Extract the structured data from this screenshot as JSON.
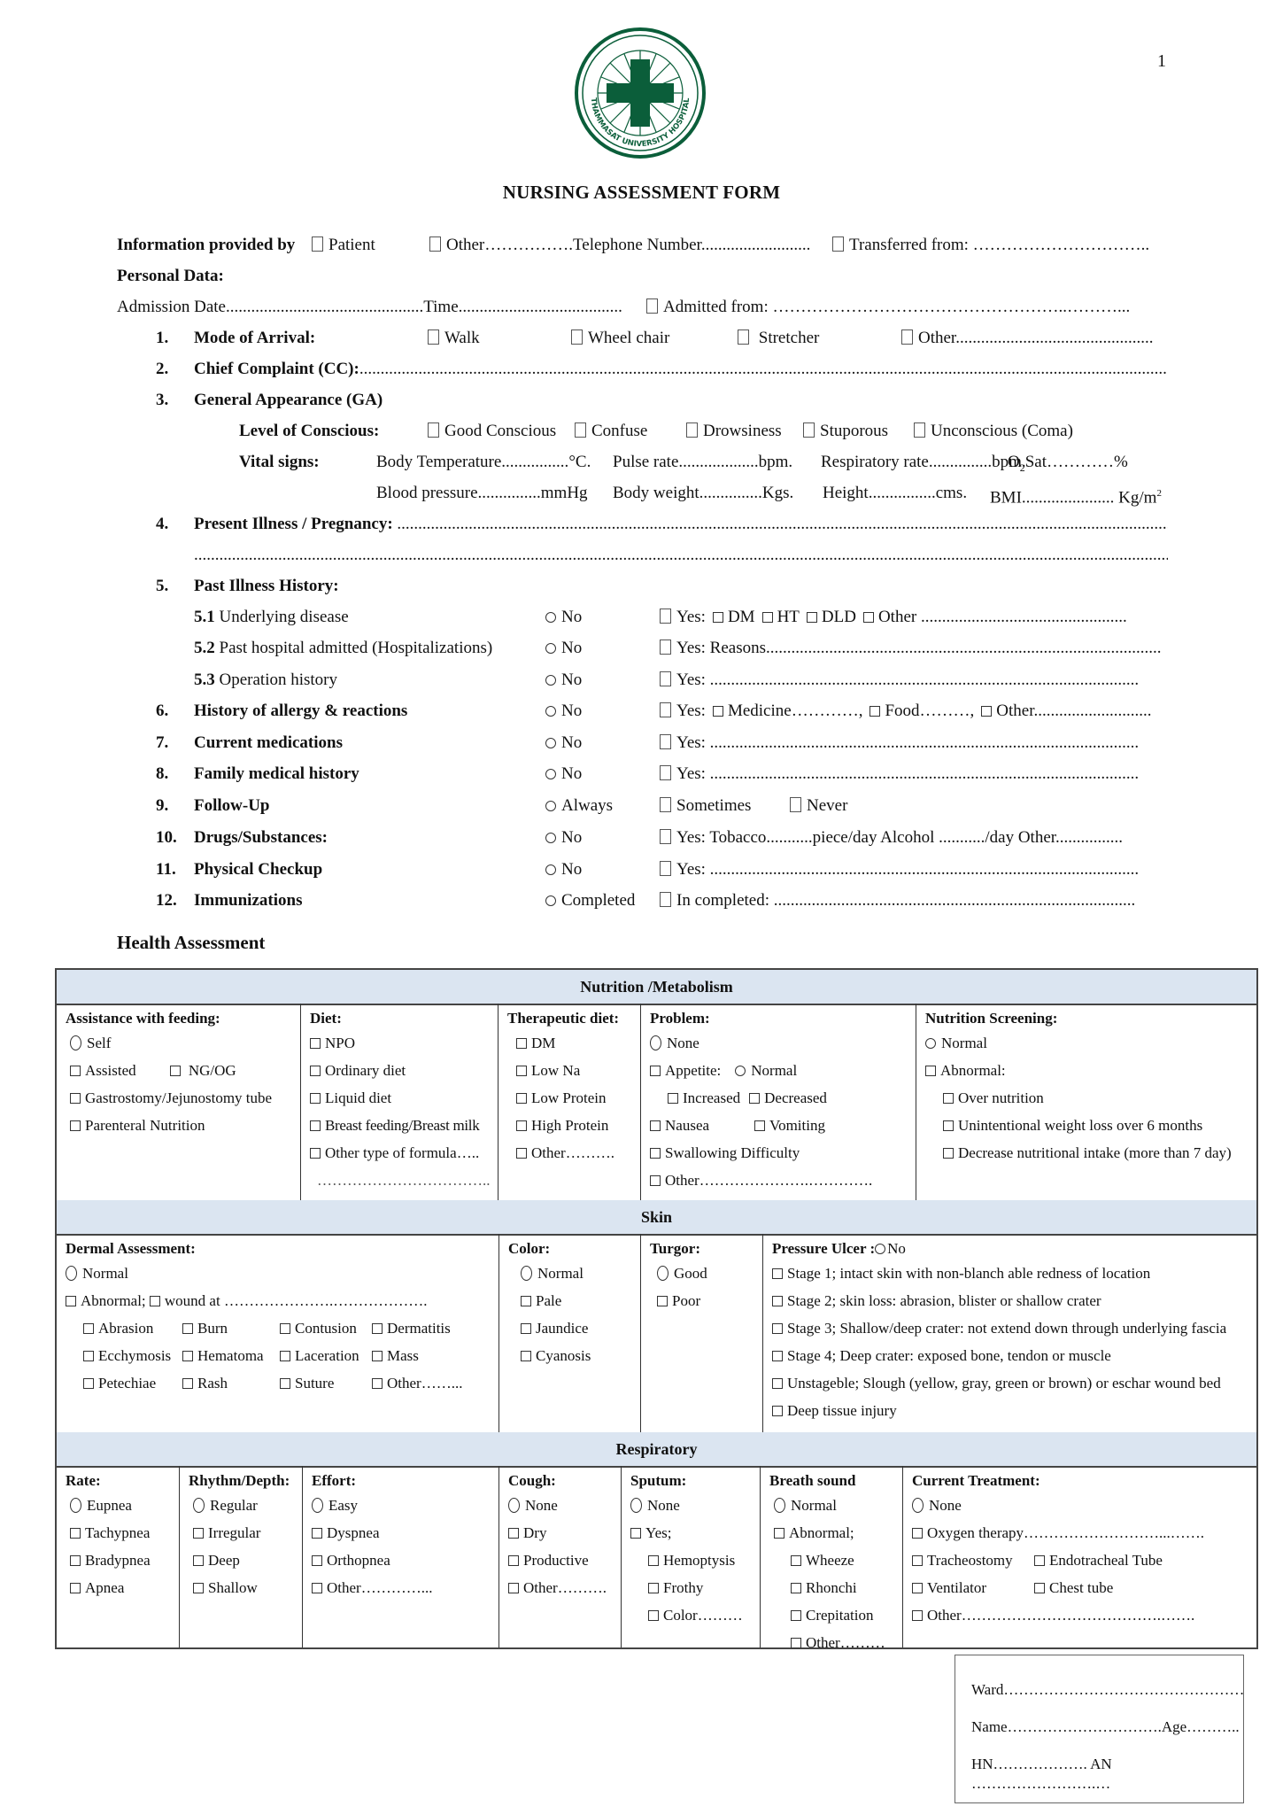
{
  "page": {
    "number": "1",
    "title": "NURSING ASSESSMENT FORM",
    "logo": {
      "icon": "hospital-seal-cross-icon",
      "text": "THAMMASAT UNIVERSITY HOSPITAL",
      "color": "#0b5e3a"
    }
  },
  "info": {
    "label": "Information provided by",
    "patient": "Patient",
    "other": "Other…………….Telephone Number..........................",
    "transferred": "Transferred from: …………………………..",
    "personal_label": "Personal Data:",
    "admission": "Admission Date...............................................Time.......................................",
    "admitted_from": "Admitted from: ……………………………………………..………..."
  },
  "items": {
    "i1": {
      "num": "1.",
      "label": "Mode of Arrival:",
      "options": [
        "Walk",
        "Wheel chair",
        "Stretcher",
        "Other..............................................."
      ]
    },
    "i2": {
      "num": "2.",
      "label": "Chief Complaint (CC):",
      "line": "................................................................................................................................................................................................................................................"
    },
    "i3": {
      "num": "3.",
      "label": "General Appearance (GA)",
      "conscious_label": "Level of Conscious:",
      "conscious_options": [
        "Good Conscious",
        "Confuse",
        "Drowsiness",
        "Stuporous",
        "Unconscious (Coma)"
      ],
      "vital_label": "Vital signs:",
      "vital_row1": [
        "Body Temperature................",
        "°C.",
        "Pulse rate...................bpm.",
        "Respiratory rate...............bpm.",
        "O",
        "2",
        "Sat…………%"
      ],
      "vital_row2": [
        "Blood pressure...............mmHg",
        "Body weight...............Kgs.",
        "Height................cms.",
        "BMI...................... Kg/m",
        "2"
      ]
    },
    "i4": {
      "num": "4.",
      "label": "Present Illness / Pregnancy:",
      "line1": "..................................................................................................................................................................................................................",
      "line2": "....................................................................................................................................................................................................................................................."
    },
    "i5": {
      "num": "5.",
      "label": "Past Illness History:"
    }
  },
  "history_rows": [
    {
      "num": "",
      "prefix": "5.1",
      "label": "Underlying disease",
      "bold": false,
      "radio": "No",
      "yes": "Yes:",
      "extra": [
        {
          "box": true,
          "text": "DM"
        },
        {
          "box": true,
          "text": "HT"
        },
        {
          "box": true,
          "text": "DLD"
        },
        {
          "box": true,
          "text": "Other ................................................."
        }
      ]
    },
    {
      "num": "",
      "prefix": "5.2",
      "label": "Past hospital admitted (Hospitalizations)",
      "bold": false,
      "radio": "No",
      "yes": "Yes: Reasons.............................................................................................."
    },
    {
      "num": "",
      "prefix": "5.3",
      "label": "Operation history",
      "bold": false,
      "radio": "No",
      "yes": "Yes:  ......................................................................................................"
    },
    {
      "num": "6.",
      "prefix": "",
      "label": "History of allergy & reactions",
      "bold": true,
      "radio": "No",
      "yes": "Yes:",
      "extra": [
        {
          "box": true,
          "text": "Medicine…………,"
        },
        {
          "box": true,
          "text": "Food………,"
        },
        {
          "box": true,
          "text": "Other............................"
        }
      ]
    },
    {
      "num": "7.",
      "prefix": "",
      "label": "Current medications",
      "bold": true,
      "radio": "No",
      "yes": "Yes:  ......................................................................................................"
    },
    {
      "num": "8.",
      "prefix": "",
      "label": "Family medical history",
      "bold": true,
      "radio": "No",
      "yes": "Yes:  ......................................................................................................"
    },
    {
      "num": "9.",
      "prefix": "",
      "label": "Follow-Up",
      "bold": true,
      "radio": "Always",
      "yes": "Sometimes",
      "never": "Never"
    },
    {
      "num": "10.",
      "prefix": "",
      "label": "Drugs/Substances:",
      "bold": true,
      "radio": "No",
      "yes": "Yes: Tobacco...........piece/day   Alcohol .........../day  Other................"
    },
    {
      "num": "11.",
      "prefix": "",
      "label": "Physical Checkup",
      "bold": true,
      "radio": "No",
      "yes": "Yes:  ......................................................................................................"
    },
    {
      "num": "12.",
      "prefix": "",
      "label": "Immunizations",
      "bold": true,
      "radio": "Completed",
      "yes": "In completed: ......................................................................................"
    }
  ],
  "health": {
    "title": "Health Assessment",
    "header_color": "#dbe5f1",
    "nutrition": {
      "title": "Nutrition /Metabolism",
      "feeding": {
        "title": "Assistance with feeding:",
        "self": "Self",
        "assisted": "Assisted",
        "ngog": "NG/OG",
        "gastro": "Gastrostomy/Jejunostomy tube",
        "parenteral": "Parenteral Nutrition"
      },
      "diet": {
        "title": "Diet:",
        "items": [
          "NPO",
          "Ordinary diet",
          "Liquid diet",
          "Breast feeding/Breast milk",
          "Other type of formula….."
        ],
        "line": "…………………………….."
      },
      "therapeutic": {
        "title": "Therapeutic diet:",
        "items": [
          "DM",
          "Low Na",
          "Low Protein",
          "High Protein",
          "Other………."
        ]
      },
      "problem": {
        "title": "Problem:",
        "none": "None",
        "appetite": "Appetite:",
        "normal": "Normal",
        "increased": "Increased",
        "decreased": "Decreased",
        "nausea": "Nausea",
        "vomiting": "Vomiting",
        "swallowing": "Swallowing Difficulty",
        "other": "Other………………….…………."
      },
      "screening": {
        "title": "Nutrition Screening:",
        "normal": "Normal",
        "abnormal": "Abnormal:",
        "items": [
          "Over nutrition",
          "Unintentional weight loss over 6 months",
          "Decrease nutritional intake (more than 7 day)"
        ]
      }
    },
    "skin": {
      "title": "Skin",
      "dermal": {
        "title": "Dermal Assessment:",
        "normal": "Normal",
        "abnormal": "Abnormal;",
        "wound": "wound at ………………….……………….",
        "grid": [
          [
            "Abrasion",
            "Burn",
            "Contusion",
            "Dermatitis"
          ],
          [
            "Ecchymosis",
            "Hematoma",
            "Laceration",
            "Mass"
          ],
          [
            "Petechiae",
            "Rash",
            "Suture",
            "Other……..."
          ]
        ]
      },
      "color": {
        "title": "Color:",
        "normal": "Normal",
        "items": [
          "Pale",
          "Jaundice",
          "Cyanosis"
        ]
      },
      "turgor": {
        "title": "Turgor:",
        "good": "Good",
        "poor": "Poor"
      },
      "pressure": {
        "title": "Pressure Ulcer :",
        "no": "No",
        "items": [
          "Stage 1; intact skin with non-blanch able redness of  location",
          "Stage 2; skin loss: abrasion, blister or shallow crater",
          "Stage 3; Shallow/deep crater: not extend down through underlying fascia",
          "Stage 4; Deep crater: exposed bone, tendon or muscle",
          "Unstageble; Slough (yellow,  gray, green or brown) or eschar wound bed",
          "Deep tissue injury"
        ]
      }
    },
    "respiratory": {
      "title": "Respiratory",
      "rate": {
        "title": "Rate:",
        "radio": "Eupnea",
        "items": [
          "Tachypnea",
          "Bradypnea",
          "Apnea"
        ]
      },
      "rhythm": {
        "title": "Rhythm/Depth:",
        "radio": "Regular",
        "items": [
          "Irregular",
          "Deep",
          "Shallow"
        ]
      },
      "effort": {
        "title": "Effort:",
        "radio": "Easy",
        "items": [
          "Dyspnea",
          "Orthopnea",
          "Other…………..."
        ]
      },
      "cough": {
        "title": "Cough:",
        "radio": "None",
        "items": [
          "Dry",
          "Productive",
          "Other………."
        ]
      },
      "sputum": {
        "title": "Sputum:",
        "radio": "None",
        "yes": "Yes;",
        "items": [
          "Hemoptysis",
          "Frothy",
          "Color………"
        ]
      },
      "breath": {
        "title": "Breath sound",
        "radio": "Normal",
        "abnormal": "Abnormal;",
        "items": [
          "Wheeze",
          "Rhonchi",
          "Crepitation",
          "Other………"
        ]
      },
      "treatment": {
        "title": "Current Treatment:",
        "radio": "None",
        "oxygen": "Oxygen therapy………………………...…….",
        "tracheostomy": "Tracheostomy",
        "endotracheal": "Endotracheal Tube",
        "ventilator": "Ventilator",
        "chest_tube": "Chest tube",
        "other": "Other………………………………….……."
      }
    }
  },
  "id_box": {
    "ward": "Ward…………………………………………",
    "name": "Name………………………….Age………..",
    "hn_an": "HN………………. AN …………………….…"
  }
}
